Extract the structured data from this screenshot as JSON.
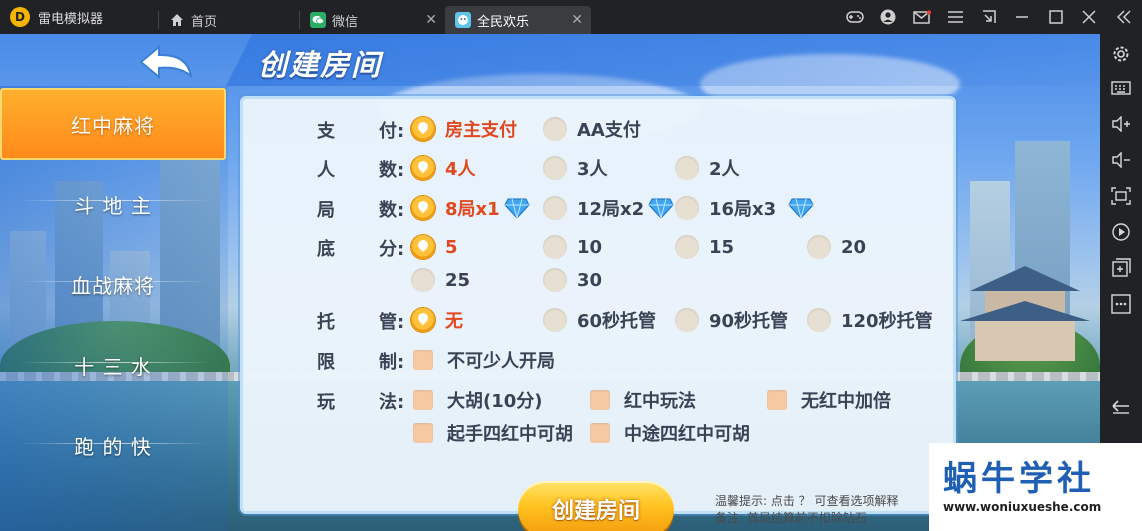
{
  "titlebar": {
    "app_name": "雷电模拟器",
    "tabs": [
      {
        "label": "首页",
        "icon": "home-icon"
      },
      {
        "label": "微信",
        "icon": "wechat-icon"
      },
      {
        "label": "全民欢乐",
        "icon": "game-icon",
        "active": true
      }
    ],
    "controls": [
      "gamepad-icon",
      "account-icon",
      "mail-icon",
      "menu-icon",
      "shrink-icon",
      "minimize-icon",
      "maximize-icon",
      "close-icon",
      "collapse-icon"
    ]
  },
  "toolbar": {
    "items": [
      "settings-icon",
      "keyboard-icon",
      "volume-up-icon",
      "volume-down-icon",
      "screenshot-icon",
      "record-icon",
      "add-app-icon",
      "more-icon",
      "back-icon"
    ]
  },
  "header": {
    "title": "创建房间"
  },
  "sidebar": {
    "items": [
      {
        "label": "红中麻将",
        "active": true
      },
      {
        "label": "斗 地 主"
      },
      {
        "label": "血战麻将"
      },
      {
        "label": "十 三 水"
      },
      {
        "label": "跑 的 快"
      }
    ]
  },
  "form": {
    "rows": [
      {
        "c1": "支",
        "c2": "付:",
        "options": [
          {
            "label": "房主支付",
            "selected": true
          },
          {
            "label": "AA支付"
          }
        ]
      },
      {
        "c1": "人",
        "c2": "数:",
        "options": [
          {
            "label": "4人",
            "selected": true
          },
          {
            "label": "3人"
          },
          {
            "label": "2人"
          }
        ]
      },
      {
        "c1": "局",
        "c2": "数:",
        "options": [
          {
            "label": "8局x1",
            "selected": true
          },
          {
            "label": "12局x2"
          },
          {
            "label": "16局x3"
          }
        ]
      },
      {
        "c1": "底",
        "c2": "分:",
        "options": [
          {
            "label": "5",
            "selected": true
          },
          {
            "label": "10"
          },
          {
            "label": "15"
          },
          {
            "label": "20"
          },
          {
            "label": "25"
          },
          {
            "label": "30"
          }
        ]
      },
      {
        "c1": "托",
        "c2": "管:",
        "options": [
          {
            "label": "无",
            "selected": true
          },
          {
            "label": "60秒托管"
          },
          {
            "label": "90秒托管"
          },
          {
            "label": "120秒托管"
          }
        ]
      },
      {
        "c1": "限",
        "c2": "制:",
        "options": [
          {
            "label": "不可少人开局"
          }
        ]
      },
      {
        "c1": "玩",
        "c2": "法:",
        "options": [
          {
            "label": "大胡(10分)"
          },
          {
            "label": "红中玩法"
          },
          {
            "label": "无红中加倍"
          },
          {
            "label": "起手四红中可胡"
          },
          {
            "label": "中途四红中可胡"
          }
        ]
      }
    ],
    "create_button": "创建房间",
    "tip_line1": "温馨提示: 点击 ？ 可查看选项解释",
    "tip_line2": "备注: 首局结算前不扣除钻石"
  },
  "watermark": {
    "title": "蜗牛学社",
    "url": "www.woniuxueshe.com"
  },
  "colors": {
    "accent": "#ff9a1f",
    "selected_text": "#e0481f",
    "titlebar": "#202225",
    "watermark_blue": "#1f5fb4"
  }
}
